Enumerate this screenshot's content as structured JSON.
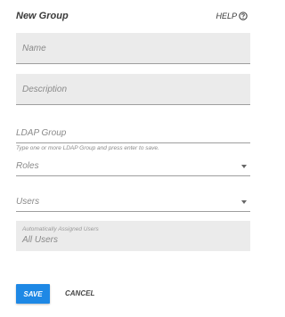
{
  "dialog": {
    "title": "New Group",
    "help_label": "HELP",
    "help_icon": "help-circle-icon"
  },
  "form": {
    "name_placeholder": "Name",
    "description_placeholder": "Description",
    "ldap_group_label": "LDAP Group",
    "ldap_hint": "Type one or more LDAP Group and press enter to save.",
    "roles_label": "Roles",
    "users_label": "Users",
    "auto_assigned_label": "Automatically Assigned Users",
    "auto_assigned_value": "All Users"
  },
  "actions": {
    "save_label": "SAVE",
    "cancel_label": "CANCEL"
  },
  "colors": {
    "primary": "#1e88e5",
    "field_bg": "#ebebeb"
  }
}
